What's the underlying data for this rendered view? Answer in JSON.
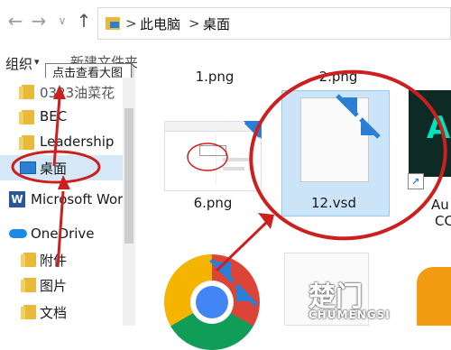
{
  "nav": {
    "back": "←",
    "forward": "→",
    "dropdown": "∨",
    "up": "↑",
    "breadcrumb": [
      "此电脑",
      "桌面"
    ],
    "separator": ">"
  },
  "toolbar": {
    "organize": "组织",
    "organize_arrow": "▾",
    "new_folder": "新建文件夹",
    "tooltip": "点击查看大图"
  },
  "sidebar": {
    "items": [
      {
        "label": "0323油菜花",
        "icon": "folder-icon"
      },
      {
        "label": "BEC",
        "icon": "folder-icon"
      },
      {
        "label": "Leadership",
        "icon": "folder-icon"
      },
      {
        "label": "桌面",
        "icon": "desktop-icon",
        "selected": true
      },
      {
        "label": "Microsoft Wor",
        "icon": "word-icon"
      },
      {
        "label": "OneDrive",
        "icon": "cloud-icon"
      },
      {
        "label": "附件",
        "icon": "folder-icon"
      },
      {
        "label": "图片",
        "icon": "folder-icon"
      },
      {
        "label": "文档",
        "icon": "folder-icon"
      }
    ]
  },
  "files": [
    {
      "name": "1.png"
    },
    {
      "name": "2.png"
    },
    {
      "name": "6.png"
    },
    {
      "name": "12.vsd",
      "selected": true
    },
    {
      "name": "Au",
      "sub": "CC"
    },
    {
      "name": ""
    }
  ],
  "colors": {
    "annotation_red": "#cc1f1f",
    "selection_blue": "#cce4f7",
    "arrow_blue": "#2a7fd4"
  },
  "watermark": {
    "logo": "楚门",
    "text": "CHUMENGSI"
  }
}
